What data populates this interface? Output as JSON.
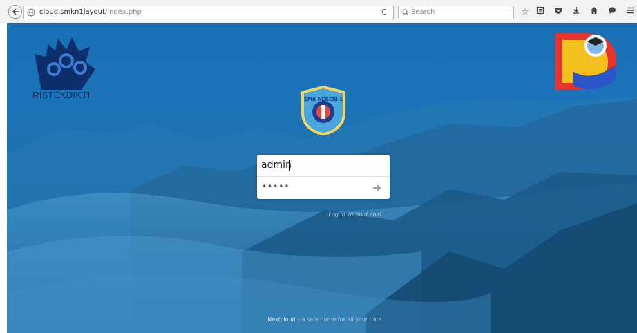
{
  "browser": {
    "url_host": "cloud.smkn1layout",
    "url_path": "/index.php",
    "search_placeholder": "Search",
    "reload_glyph": "C"
  },
  "logos": {
    "left_label": "RISTEKDIKTI",
    "center_text": "SMK NEGERI 1"
  },
  "login": {
    "username_value": "admin",
    "password_mask": "•••••",
    "alt_link": "Log in without chat"
  },
  "footer": {
    "brand": "Nextcloud",
    "tagline": " – a safe home for all your data"
  },
  "colors": {
    "background_top": "#1a6fb3",
    "background_bottom": "#17567f",
    "login_box": "#ffffff"
  },
  "icons": [
    "back-arrow-icon",
    "site-info-icon",
    "reload-icon",
    "search-icon",
    "star-icon",
    "reading-list-icon",
    "pocket-icon",
    "download-icon",
    "home-icon",
    "chat-icon",
    "menu-icon",
    "submit-arrow-icon"
  ]
}
